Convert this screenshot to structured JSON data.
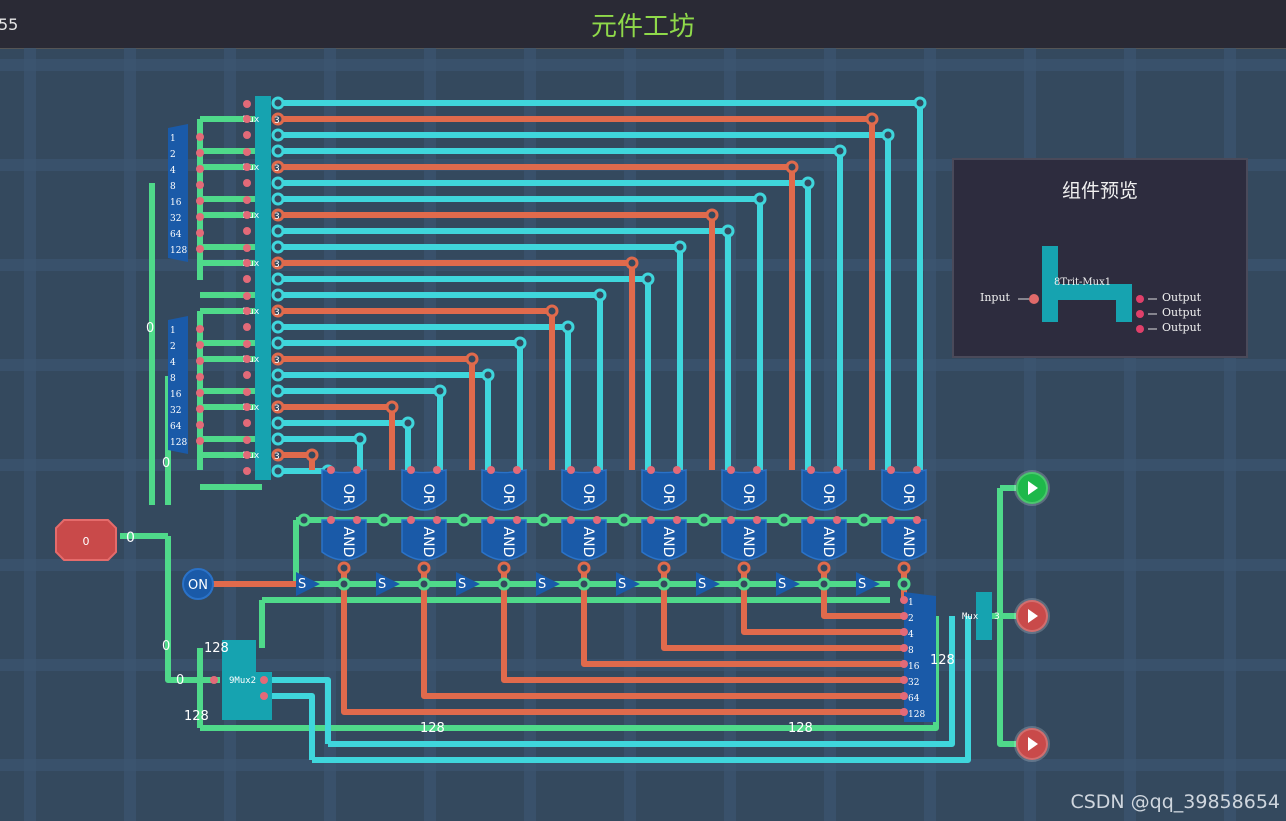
{
  "window": {
    "title": "元件工坊",
    "left_counter": "55"
  },
  "preview": {
    "title": "组件预览",
    "component_name": "8Trit-Mux1",
    "input_label": "Input",
    "output_labels": [
      "Output",
      "Output",
      "Output"
    ]
  },
  "circuit": {
    "input_value": "0",
    "switch_label": "ON",
    "bit_labels": [
      "1",
      "2",
      "4",
      "8",
      "16",
      "32",
      "64",
      "128"
    ],
    "mux_label": "Mux",
    "mux_count": "3",
    "gate_or": "OR",
    "gate_and": "AND",
    "switch_gate": "S",
    "mux2_label": "9Mux2",
    "wire_value_zero": "0",
    "wire_value_128": "128"
  },
  "colors": {
    "background": "#34495e",
    "green_wire": "#4fd98a",
    "cyan_wire": "#3fd6dc",
    "orange_wire": "#e06a4c",
    "accent": "#8fd94a"
  },
  "watermark": "CSDN @qq_39858654"
}
